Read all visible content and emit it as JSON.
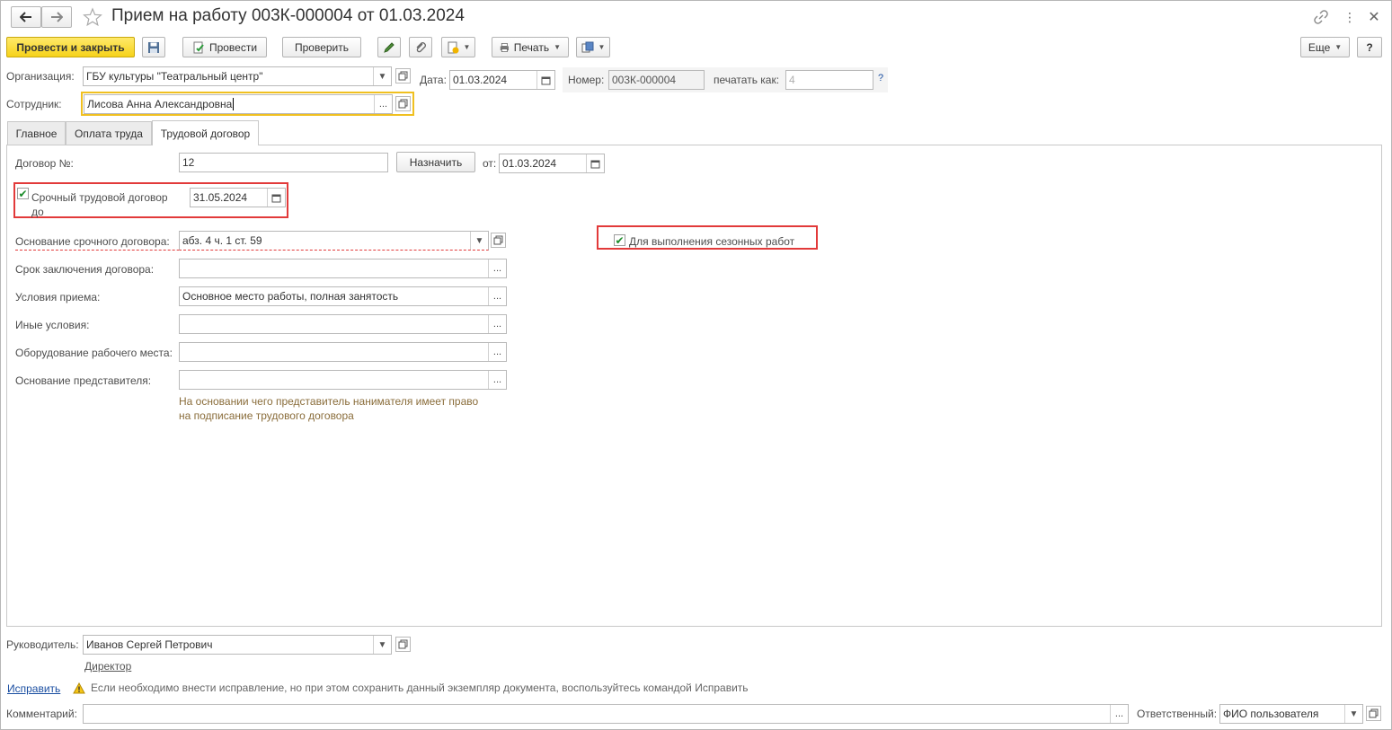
{
  "window": {
    "title": "Прием на работу 003К-000004 от 01.03.2024"
  },
  "toolbar": {
    "post_and_close": "Провести и закрыть",
    "post": "Провести",
    "check": "Проверить",
    "print": "Печать",
    "more": "Еще",
    "help": "?"
  },
  "header": {
    "org_label": "Организация:",
    "org_value": "ГБУ культуры \"Театральный центр\"",
    "date_label": "Дата:",
    "date_value": "01.03.2024",
    "number_label": "Номер:",
    "number_value": "003К-000004",
    "print_as_label": "печатать как:",
    "print_as_value": "4",
    "print_as_help": "?",
    "employee_label": "Сотрудник:",
    "employee_value": "Лисова Анна Александровна"
  },
  "tabs": [
    {
      "label": "Главное"
    },
    {
      "label": "Оплата труда"
    },
    {
      "label": "Трудовой договор"
    }
  ],
  "contract": {
    "number_label": "Договор №:",
    "number_value": "12",
    "assign_button": "Назначить",
    "from_label": "от:",
    "from_value": "01.03.2024",
    "fixed_term_label_1": "Срочный трудовой договор",
    "fixed_term_label_2": "до",
    "fixed_term_checked": true,
    "fixed_term_date": "31.05.2024",
    "seasonal_label": "Для выполнения сезонных работ",
    "seasonal_checked": true,
    "basis_label": "Основание срочного договора:",
    "basis_value": "абз. 4 ч. 1 ст. 59",
    "term_label": "Срок заключения договора:",
    "term_value": "",
    "conditions_label": "Условия приема:",
    "conditions_value": "Основное место работы, полная занятость",
    "other_label": "Иные условия:",
    "other_value": "",
    "equipment_label": "Оборудование рабочего места:",
    "equipment_value": "",
    "rep_basis_label": "Основание представителя:",
    "rep_basis_value": "",
    "rep_hint_1": "На основании чего представитель нанимателя имеет право",
    "rep_hint_2": "на подписание трудового договора"
  },
  "footer": {
    "manager_label": "Руководитель:",
    "manager_value": "Иванов Сергей Петрович",
    "manager_position": "Директор",
    "fix_link": "Исправить",
    "fix_hint": "Если необходимо внести исправление, но при этом сохранить данный экземпляр документа, воспользуйтесь командой Исправить",
    "comment_label": "Комментарий:",
    "comment_value": "",
    "responsible_label": "Ответственный:",
    "responsible_value": "ФИО пользователя"
  },
  "colors": {
    "primary_button": "#f6d21a",
    "highlight_box": "#e23a3a",
    "focus_border": "#f0c020",
    "link": "#1a4ea1",
    "check": "#1c8c2a"
  }
}
